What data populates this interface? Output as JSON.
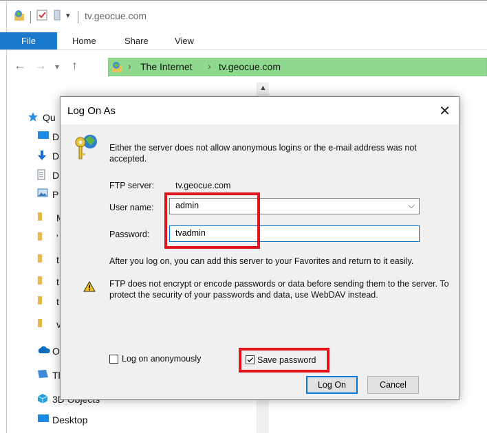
{
  "window": {
    "title": "tv.geocue.com"
  },
  "ribbon": {
    "tabs": [
      "File",
      "Home",
      "Share",
      "View"
    ]
  },
  "address": {
    "crumbs": [
      "The Internet",
      "tv.geocue.com"
    ]
  },
  "nav": {
    "items": [
      {
        "icon": "star-icon",
        "label": "Qu",
        "color": "#2d8fe0"
      },
      {
        "icon": "desktop-icon",
        "label": "D",
        "color": "#1e88e5"
      },
      {
        "icon": "download-icon",
        "label": "D",
        "color": "#1e6fd9"
      },
      {
        "icon": "document-icon",
        "label": "D",
        "color": "#6c7a89"
      },
      {
        "icon": "picture-icon",
        "label": "P",
        "color": "#3a7bbf"
      },
      {
        "icon": "folder-icon",
        "label": "M",
        "color": "#e6b84a"
      },
      {
        "icon": "folder-icon",
        "label": "'",
        "color": "#e6b84a"
      },
      {
        "icon": "folder-icon",
        "label": "t",
        "color": "#e6b84a"
      },
      {
        "icon": "folder-icon",
        "label": "t",
        "color": "#e6b84a"
      },
      {
        "icon": "folder-icon",
        "label": "t",
        "color": "#e6b84a"
      },
      {
        "icon": "folder-icon",
        "label": "v",
        "color": "#e6b84a"
      },
      {
        "icon": "onedrive-icon",
        "label": "Or",
        "color": "#0f6cbd"
      },
      {
        "icon": "pc-icon",
        "label": "Th",
        "color": "#3c8bd9"
      },
      {
        "icon": "3d-objects-icon",
        "label": "3D Objects",
        "color": "#27a3d9"
      },
      {
        "icon": "desktop-icon",
        "label": "Desktop",
        "color": "#1e88e5"
      }
    ]
  },
  "dialog": {
    "title": "Log On As",
    "message": "Either the server does not allow anonymous logins or the e-mail address was not accepted.",
    "ftp_server_label": "FTP server:",
    "ftp_server_value": "tv.geocue.com",
    "username_label": "User name:",
    "username_value": "admin",
    "password_label": "Password:",
    "password_value": "tvadmin",
    "info": "After you log on, you can add this server to your Favorites and return to it easily.",
    "warning": "FTP does not encrypt or encode passwords or data before sending them to the server.  To protect the security of your passwords and data, use WebDAV instead.",
    "anonymous_label": "Log on anonymously",
    "anonymous_checked": false,
    "save_password_label": "Save password",
    "save_password_checked": true,
    "logon_button": "Log On",
    "cancel_button": "Cancel"
  },
  "highlight_color": "#e0141e"
}
